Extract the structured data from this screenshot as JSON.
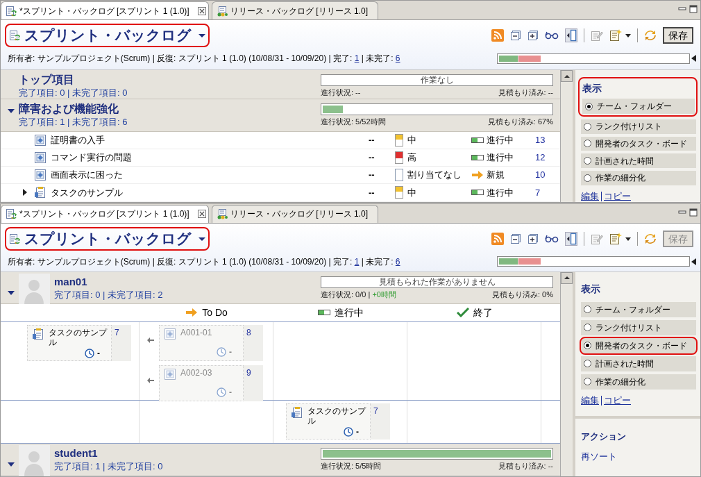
{
  "panels": [
    {
      "tabs": [
        {
          "label": "*スプリント・バックログ [スプリント 1 (1.0)]",
          "selected": true,
          "closable": true
        },
        {
          "label": "リリース・バックログ [リリース 1.0]",
          "selected": false
        }
      ],
      "title": "スプリント・バックログ",
      "title_highlighted": true,
      "save_button": {
        "label": "保存",
        "enabled": true
      },
      "summary": [
        {
          "text": "所有者: サンプルプロジェクト(Scrum) | 反復: スプリント 1 (1.0) (10/08/31 - 10/09/20) | 完了:",
          "link": false
        },
        {
          "text": "1",
          "link": true
        },
        {
          "text": "| 未完了:",
          "link": false
        },
        {
          "text": "6",
          "link": true
        }
      ],
      "overall_progress": [
        {
          "level": 0.1,
          "color": "#80b880"
        },
        {
          "level": 0.12,
          "color": "#e89090"
        }
      ],
      "groups": [
        {
          "kind": "category",
          "name": "トップ項目",
          "counts": "完了項目: 0 | 未完了項目: 0",
          "bar_text": "作業なし",
          "level": 0,
          "progress": "進行状況: --",
          "estimate": "見積もり済み: --"
        },
        {
          "kind": "category",
          "name": "障害および機能強化",
          "expanded": true,
          "counts": "完了項目: 1 | 未完了項目: 6",
          "level": 0.1,
          "progress": "進行状況: 5/52時間",
          "estimate": "見積もり済み: 67%",
          "items": [
            {
              "kind": "defect",
              "title": "証明書の入手",
              "estimate": "--",
              "priority": {
                "kind": "medium",
                "label": "中"
              },
              "status": {
                "kind": "in_progress",
                "label": "進行中"
              },
              "id": "13"
            },
            {
              "kind": "defect",
              "title": "コマンド実行の問題",
              "estimate": "--",
              "priority": {
                "kind": "high",
                "label": "高"
              },
              "status": {
                "kind": "in_progress",
                "label": "進行中"
              },
              "id": "12"
            },
            {
              "kind": "defect",
              "title": "画面表示に困った",
              "estimate": "--",
              "priority": {
                "kind": "none",
                "label": "割り当てなし"
              },
              "status": {
                "kind": "new",
                "label": "新規"
              },
              "id": "10"
            },
            {
              "kind": "task",
              "expanded": false,
              "title": "タスクのサンプル",
              "estimate": "--",
              "priority": {
                "kind": "medium",
                "label": "中"
              },
              "status": {
                "kind": "in_progress",
                "label": "進行中"
              },
              "id": "7"
            }
          ]
        }
      ],
      "sidebar": {
        "heading": "表示",
        "heading_highlighted": true,
        "options": [
          {
            "label": "チーム・フォルダー",
            "selected": true,
            "highlighted": false
          },
          {
            "label": "ランク付けリスト",
            "selected": false,
            "highlighted": false
          },
          {
            "label": "開発者のタスク・ボード",
            "selected": false,
            "highlighted": false
          },
          {
            "label": "計画された時間",
            "selected": false,
            "highlighted": false
          },
          {
            "label": "作業の細分化",
            "selected": false,
            "highlighted": false
          }
        ],
        "links": [
          "編集",
          "コピー"
        ]
      }
    },
    {
      "tabs": [
        {
          "label": "*スプリント・バックログ [スプリント 1 (1.0)]",
          "selected": true,
          "closable": true
        },
        {
          "label": "リリース・バックログ [リリース 1.0]",
          "selected": false
        }
      ],
      "title": "スプリント・バックログ",
      "title_highlighted": true,
      "save_button": {
        "label": "保存",
        "enabled": false
      },
      "summary": [
        {
          "text": "所有者: サンプルプロジェクト(Scrum) | 反復: スプリント 1 (1.0) (10/08/31 - 10/09/20) | 完了:",
          "link": false
        },
        {
          "text": "1",
          "link": true
        },
        {
          "text": "| 未完了:",
          "link": false
        },
        {
          "text": "6",
          "link": true
        }
      ],
      "overall_progress": [
        {
          "level": 0.1,
          "color": "#80b880"
        },
        {
          "level": 0.12,
          "color": "#e89090"
        }
      ],
      "groups": [
        {
          "kind": "developer",
          "name": "man01",
          "expanded": true,
          "counts": "完了項目: 0 | 未完了項目: 2",
          "bar_text": "見積もられた作業がありません",
          "level": 0,
          "progress": "進行状況: 0/0 |",
          "progress_delta": "+0時間",
          "estimate": "見積もり済み: 0%",
          "board": {
            "columns": [
              {
                "label": "To Do"
              },
              {
                "label": "進行中"
              },
              {
                "label": "終了"
              }
            ],
            "rows": [
              {
                "parent": {
                  "kind": "task",
                  "title": "タスクのサンプル",
                  "id": "7",
                  "estimate": "-"
                },
                "cells": [
                  [
                    {
                      "kind": "defect",
                      "title": "A001-01",
                      "id": "8",
                      "estimate": "-"
                    },
                    {
                      "kind": "defect",
                      "title": "A002-03",
                      "id": "9",
                      "estimate": "-"
                    }
                  ],
                  [],
                  []
                ]
              },
              {
                "cells": [
                  [],
                  [
                    {
                      "kind": "task",
                      "title": "タスクのサンプル",
                      "id": "7",
                      "estimate": "-"
                    }
                  ],
                  []
                ]
              }
            ]
          }
        },
        {
          "kind": "developer",
          "name": "student1",
          "expanded": true,
          "counts": "完了項目: 1 | 未完了項目: 0",
          "level": 1,
          "progress": "進行状況: 5/5時間",
          "estimate": "見積もり済み: --"
        }
      ],
      "sidebar": {
        "heading": "表示",
        "heading_highlighted": false,
        "options": [
          {
            "label": "チーム・フォルダー",
            "selected": false,
            "highlighted": false
          },
          {
            "label": "ランク付けリスト",
            "selected": false,
            "highlighted": false
          },
          {
            "label": "開発者のタスク・ボード",
            "selected": true,
            "highlighted": true
          },
          {
            "label": "計画された時間",
            "selected": false,
            "highlighted": false
          },
          {
            "label": "作業の細分化",
            "selected": false,
            "highlighted": false
          }
        ],
        "links": [
          "編集",
          "コピー"
        ],
        "actions": {
          "heading": "アクション",
          "links": [
            "再ソート"
          ]
        }
      }
    }
  ]
}
